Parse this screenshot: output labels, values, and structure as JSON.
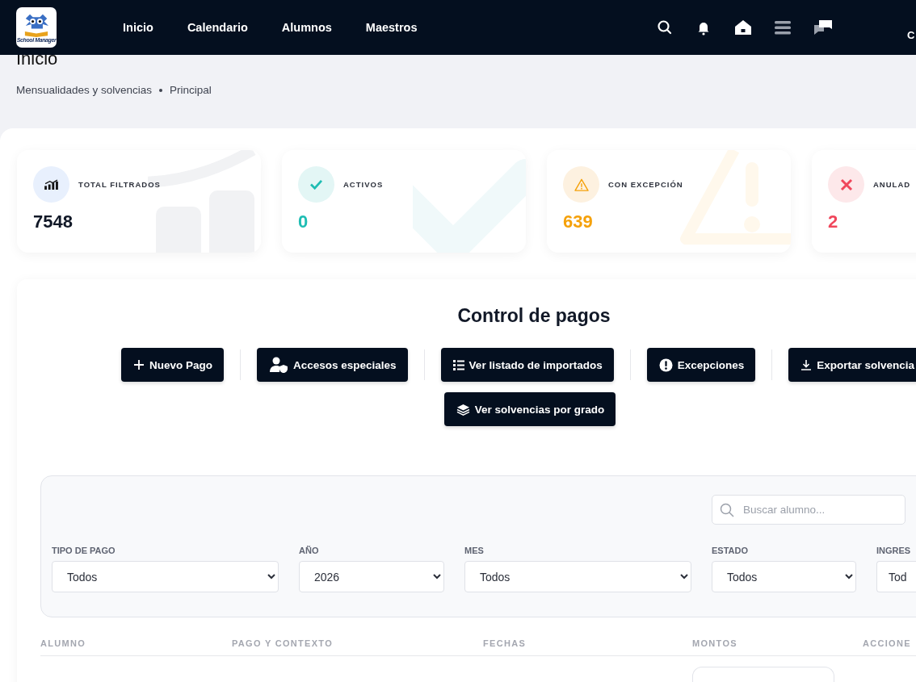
{
  "nav": {
    "logo_text": "School Manager",
    "links": [
      {
        "label": "Inicio"
      },
      {
        "label": "Calendario"
      },
      {
        "label": "Alumnos"
      },
      {
        "label": "Maestros"
      }
    ],
    "icons": [
      {
        "kind": "search"
      },
      {
        "kind": "bell"
      },
      {
        "kind": "home"
      },
      {
        "kind": "menu"
      },
      {
        "kind": "chat"
      }
    ],
    "user": "C"
  },
  "header": {
    "title": "Inicio",
    "breadcrumb": [
      "Mensualidades y solvencias",
      "Principal"
    ]
  },
  "stats": [
    {
      "kind": "total",
      "label": "TOTAL FILTRADOS",
      "value": "7548"
    },
    {
      "kind": "active",
      "label": "ACTIVOS",
      "value": "0"
    },
    {
      "kind": "exception",
      "label": "CON EXCEPCIÓN",
      "value": "639"
    },
    {
      "kind": "cancelled",
      "label": "ANULAD",
      "value": "2"
    }
  ],
  "control": {
    "title": "Control de pagos",
    "buttons": [
      [
        {
          "kind": "plus",
          "label": "Nuevo Pago"
        },
        {
          "kind": "user-shield",
          "label": "Accesos especiales"
        },
        {
          "kind": "list",
          "label": "Ver listado de importados"
        },
        {
          "kind": "alert",
          "label": "Excepciones"
        },
        {
          "kind": "download",
          "label": "Exportar solvencia"
        }
      ],
      [
        {
          "kind": "layers",
          "label": "Ver solvencias por grado"
        }
      ]
    ],
    "search": {
      "placeholder": "Buscar alumno..."
    },
    "filters": [
      {
        "label": "TIPO DE PAGO",
        "value": "Todos"
      },
      {
        "label": "AÑO",
        "value": "2026"
      },
      {
        "label": "MES",
        "value": "Todos"
      },
      {
        "label": "ESTADO",
        "value": "Todos"
      },
      {
        "label": "INGRES",
        "value": "Tod"
      }
    ],
    "table": {
      "columns": [
        "ALUMNO",
        "PAGO Y CONTEXTO",
        "FECHAS",
        "MONTOS",
        "ACCIONE"
      ]
    }
  }
}
